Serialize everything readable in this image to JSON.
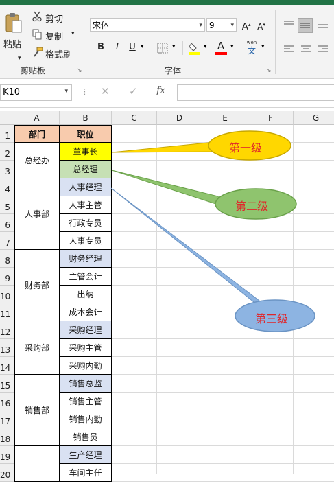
{
  "clipboard": {
    "paste": "粘贴",
    "cut": "剪切",
    "copy": "复制",
    "format_painter": "格式刷",
    "group_label": "剪贴板"
  },
  "font": {
    "name": "宋体",
    "size": "9",
    "bold": "B",
    "italic": "I",
    "underline": "U",
    "grow": "A",
    "shrink": "A",
    "group_label": "字体",
    "phonetic_top": "wén",
    "phonetic_bottom": "文"
  },
  "formula_bar": {
    "name_box": "K10",
    "value": ""
  },
  "columns": [
    "A",
    "B",
    "C",
    "D",
    "E",
    "F",
    "G"
  ],
  "rows": [
    "1",
    "2",
    "3",
    "4",
    "5",
    "6",
    "7",
    "8",
    "9",
    "10",
    "11",
    "12",
    "13",
    "14",
    "15",
    "16",
    "17",
    "18",
    "19",
    "20"
  ],
  "table": {
    "header": {
      "dept": "部门",
      "position": "职位"
    },
    "departments": [
      "总经办",
      "人事部",
      "财务部",
      "采购部",
      "销售部",
      ""
    ],
    "positions": [
      "董事长",
      "总经理",
      "人事经理",
      "人事主管",
      "行政专员",
      "人事专员",
      "财务经理",
      "主管会计",
      "出纳",
      "成本会计",
      "采购经理",
      "采购主管",
      "采购内勤",
      "销售总监",
      "销售主管",
      "销售内勤",
      "销售员",
      "生产经理",
      "车间主任"
    ]
  },
  "callouts": [
    "第一级",
    "第二级",
    "第三级"
  ],
  "colors": {
    "excel_green": "#217346",
    "header_fill": "#f8cbad",
    "level1": "#ffff00",
    "level2": "#c6e0b4",
    "level3": "#d9e1f2",
    "callout1": "#ffd700",
    "callout2": "#8fc46e",
    "callout3": "#8db4e2",
    "callout_text": "#e0262a"
  }
}
